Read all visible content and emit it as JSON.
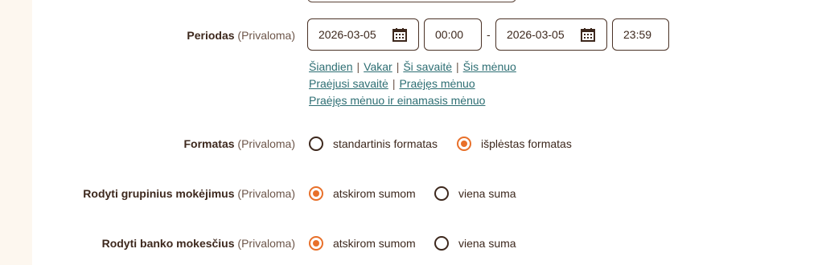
{
  "period": {
    "label": "Periodas",
    "required": "(Privaloma)",
    "date_from": "2026-03-05",
    "time_from": "00:00",
    "separator": "-",
    "date_to": "2026-03-05",
    "time_to": "23:59",
    "quick_links_row1": [
      "Šiandien",
      "Vakar",
      "Ši savaitė",
      "Šis mėnuo"
    ],
    "quick_links_row2": [
      "Praėjusi savaitė",
      "Praėjęs mėnuo"
    ],
    "quick_links_row3": [
      "Praėjęs mėnuo ir einamasis mėnuo"
    ],
    "link_separator": "|"
  },
  "format": {
    "label": "Formatas",
    "required": "(Privaloma)",
    "options": [
      "standartinis formatas",
      "išplėstas formatas"
    ],
    "selected": "išplėstas formatas"
  },
  "group_payments": {
    "label": "Rodyti grupinius mokėjimus",
    "required": "(Privaloma)",
    "options": [
      "atskirom sumom",
      "viena suma"
    ],
    "selected": "atskirom sumom"
  },
  "bank_fees": {
    "label": "Rodyti banko mokesčius",
    "required": "(Privaloma)",
    "options": [
      "atskirom sumom",
      "viena suma"
    ],
    "selected": "atskirom sumom"
  },
  "colors": {
    "accent": "#e8702a",
    "link": "#2d6e73",
    "text": "#3d281d"
  }
}
